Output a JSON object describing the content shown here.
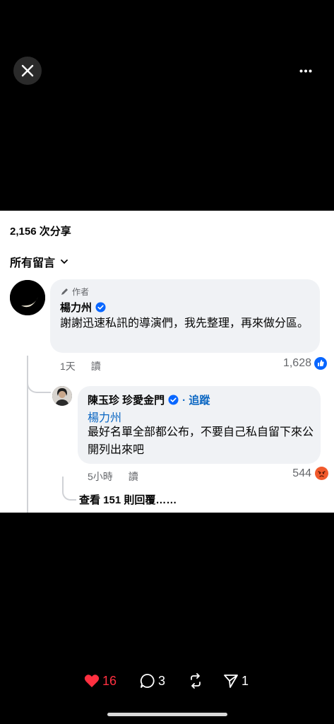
{
  "shares_text": "2,156 次分享",
  "filter_label": "所有留言",
  "comment": {
    "author_tag": "作者",
    "name": "楊力州",
    "text": "謝謝迅速私訊的導演們，我先整理，再來做分區。",
    "time": "1天",
    "reply_label": "讀",
    "likes": "1,628"
  },
  "reply": {
    "name": "陳玉珍 珍愛金門",
    "follow_label": "· 追蹤",
    "mention": "楊力州",
    "text": "最好名單全部都公布，不要自己私自留下來公開列出來吧",
    "time": "5小時",
    "reply_label": "讀",
    "likes": "544"
  },
  "more_replies": "查看 151 則回覆……",
  "actions": {
    "likes": "16",
    "comments": "3",
    "shares": "1"
  },
  "colors": {
    "accent": "#0a66c2",
    "heart": "#ff3040",
    "angry": "#f15a2c"
  }
}
